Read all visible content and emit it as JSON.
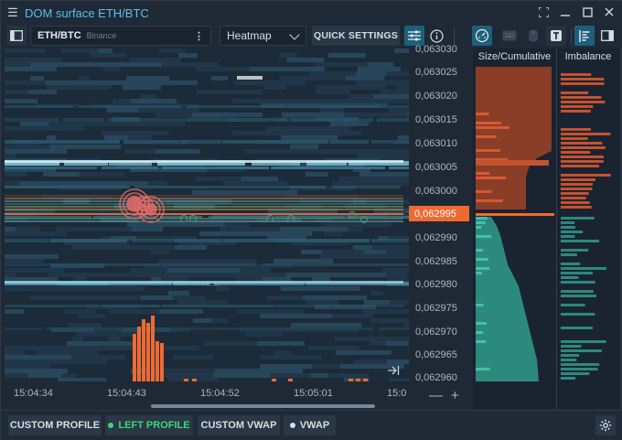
{
  "window": {
    "title": "DOM surface ETH/BTC",
    "menu_icon": "hamburger-icon",
    "controls": [
      "expand-icon",
      "minimize-icon",
      "maximize-icon",
      "close-icon"
    ]
  },
  "toolbar": {
    "symbol": "ETH/BTC",
    "exchange": "Binance",
    "view_mode": "Heatmap",
    "quick_settings": "QUICK SETTINGS"
  },
  "chart": {
    "y_labels": [
      "0,063030",
      "0,063025",
      "0,063020",
      "0,063015",
      "0,063010",
      "0,063005",
      "0,063000",
      "0,062995",
      "0,062990",
      "0,062985",
      "0,062980",
      "0,062975",
      "0,062970",
      "0,062965",
      "0,062960"
    ],
    "current_price": "0,062995",
    "x_labels": [
      "15:04:34",
      "15:04:43",
      "15:04:52",
      "15:05:01",
      "15:0"
    ],
    "zoom_out": "—",
    "zoom_in": "+",
    "colors": {
      "bid": "#3aa59a",
      "ask": "#c4522e",
      "price_tag": "#ef6a32",
      "volume": "#ef6a32"
    }
  },
  "right_panel": {
    "size_header": "Size/Cumulative",
    "imbalance_header": "Imbalance"
  },
  "bottom": {
    "custom_profile": "CUSTOM PROFILE",
    "left_profile": "LEFT PROFILE",
    "custom_vwap": "CUSTOM VWAP",
    "vwap": "VWAP",
    "left_profile_color": "#3fd47e"
  }
}
